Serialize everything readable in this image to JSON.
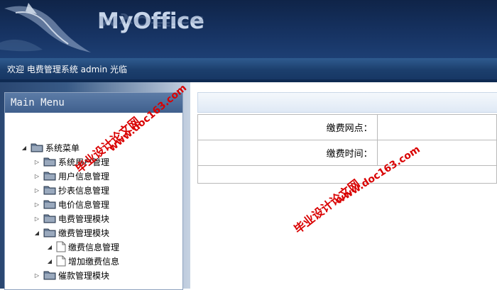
{
  "header": {
    "logo": "MyOffice"
  },
  "welcome": {
    "text": "欢迎 电费管理系统 admin 光临"
  },
  "sidebar": {
    "title": "Main Menu",
    "root": {
      "label": "系统菜单"
    },
    "items": [
      {
        "label": "系统用户管理"
      },
      {
        "label": "用户信息管理"
      },
      {
        "label": "抄表信息管理"
      },
      {
        "label": "电价信息管理"
      },
      {
        "label": "电费管理模块"
      },
      {
        "label": "缴费管理模块"
      },
      {
        "label": "缴费信息管理"
      },
      {
        "label": "增加缴费信息"
      },
      {
        "label": "催款管理模块"
      }
    ]
  },
  "form": {
    "rows": [
      {
        "label": "缴费网点："
      },
      {
        "label": "缴费时间："
      }
    ]
  },
  "watermark": {
    "site": "www.doc163.com",
    "cn": "毕业设计论文网"
  },
  "colors": {
    "header": "#163261",
    "welcome_bar": "#1c3f6d",
    "menu_header": "#4b6b98",
    "watermark": "#d90000"
  }
}
